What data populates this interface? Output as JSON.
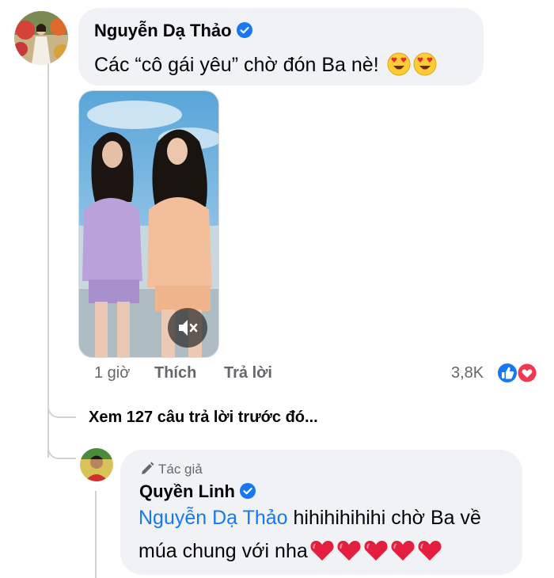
{
  "comment": {
    "author": "Nguyễn Dạ Thảo",
    "text": "Các “cô gái yêu” chờ đón Ba nè!",
    "emojis": [
      "smiling-face-with-heart-eyes",
      "smiling-face-with-heart-eyes"
    ],
    "time": "1 giờ",
    "like_label": "Thích",
    "reply_label": "Trả lời",
    "reaction_count": "3,8K",
    "reactions": [
      "like",
      "love"
    ],
    "video": {
      "muted": true
    }
  },
  "view_more": "Xem 127 câu trả lời trước đó...",
  "reply": {
    "badge": "Tác giả",
    "author": "Quyền Linh",
    "mention": "Nguyễn Dạ Thảo",
    "text_line1": "hihihihihihi chờ Ba về",
    "text_line2": "múa chung với nha",
    "hearts": 5
  },
  "colors": {
    "bubble": "#f0f2f5",
    "accent": "#1877f2",
    "meta": "#65676b",
    "heart": "#e41e3f"
  }
}
